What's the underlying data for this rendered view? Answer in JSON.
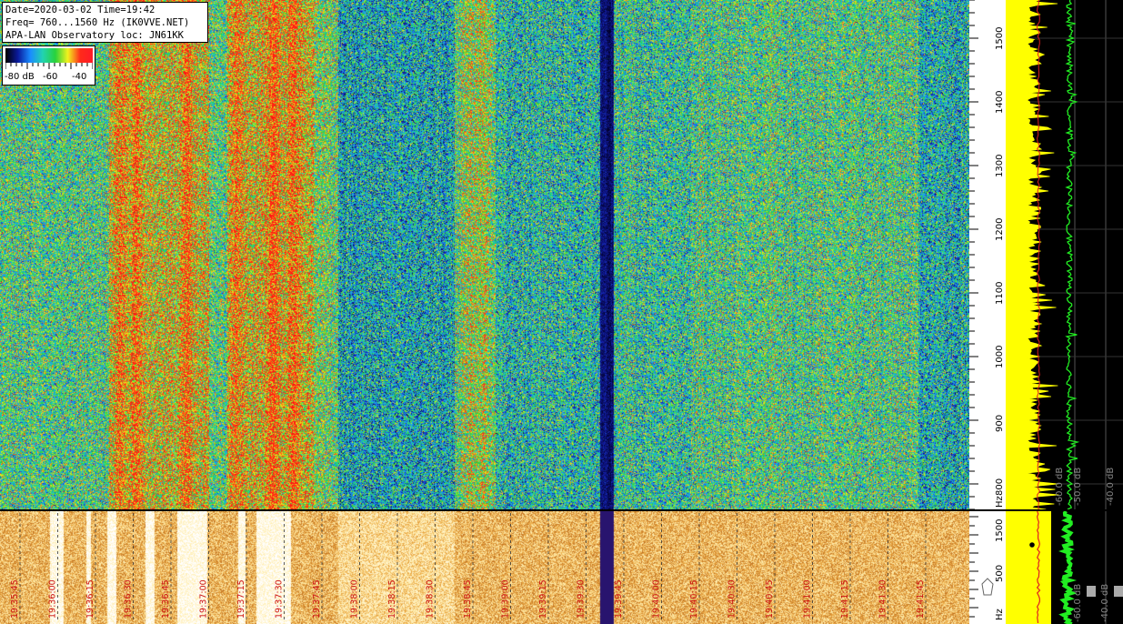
{
  "info": {
    "line1": "Date=2020-03-02 Time=19:42",
    "line2": "Freq= 760...1560 Hz (IK0VVE.NET)",
    "line3": "APA-LAN Observatory loc: JN61KK"
  },
  "colorbar": {
    "labels": [
      "-80 dB",
      "-60",
      "-40"
    ],
    "stops": [
      "#000000",
      "#0a1a9c",
      "#1a8cff",
      "#22d3b0",
      "#28d23c",
      "#f2f21e",
      "#ff2a1a",
      "#ff1a28"
    ]
  },
  "chart_data": [
    {
      "type": "heatmap",
      "title": "",
      "ylabel": "Hz",
      "ylim": [
        760,
        1560
      ],
      "y_ticks": [
        "800",
        "900",
        "1000",
        "1100",
        "1200",
        "1300",
        "1400",
        "1500"
      ],
      "colorscale_db": [
        -80,
        -40
      ]
    },
    {
      "type": "heatmap",
      "title": "",
      "ylabel": "Hz",
      "y_ticks": [
        "500",
        "1500"
      ],
      "x_ticks": [
        "19:35:45",
        "19:36:00",
        "19:36:15",
        "19:36:30",
        "19:36:45",
        "19:37:00",
        "19:37:15",
        "19:37:30",
        "19:37:45",
        "19:38:00",
        "19:38:15",
        "19:38:30",
        "19:38:45",
        "19:39:00",
        "19:39:15",
        "19:39:30",
        "19:39:45",
        "19:40:00",
        "19:40:15",
        "19:40:30",
        "19:40:45",
        "19:41:00",
        "19:41:15",
        "19:41:30",
        "19:41:45"
      ]
    },
    {
      "type": "line",
      "series": [
        {
          "name": "",
          "color": "#ffff00"
        },
        {
          "name": "",
          "color": "#22ee22"
        },
        {
          "name": "",
          "color": "#e02020"
        }
      ],
      "x_ticks": [
        "-60.0 dB",
        "-50.0 dB",
        "-40.0 dB"
      ],
      "x_ticks_lower": [
        "-60.0 dB",
        "-40.0 dB"
      ]
    }
  ],
  "colors": {
    "spectrum_yellow": "#ffff00",
    "spectrum_green": "#22ee22",
    "marker_red": "#e02020",
    "background": "#000000"
  }
}
